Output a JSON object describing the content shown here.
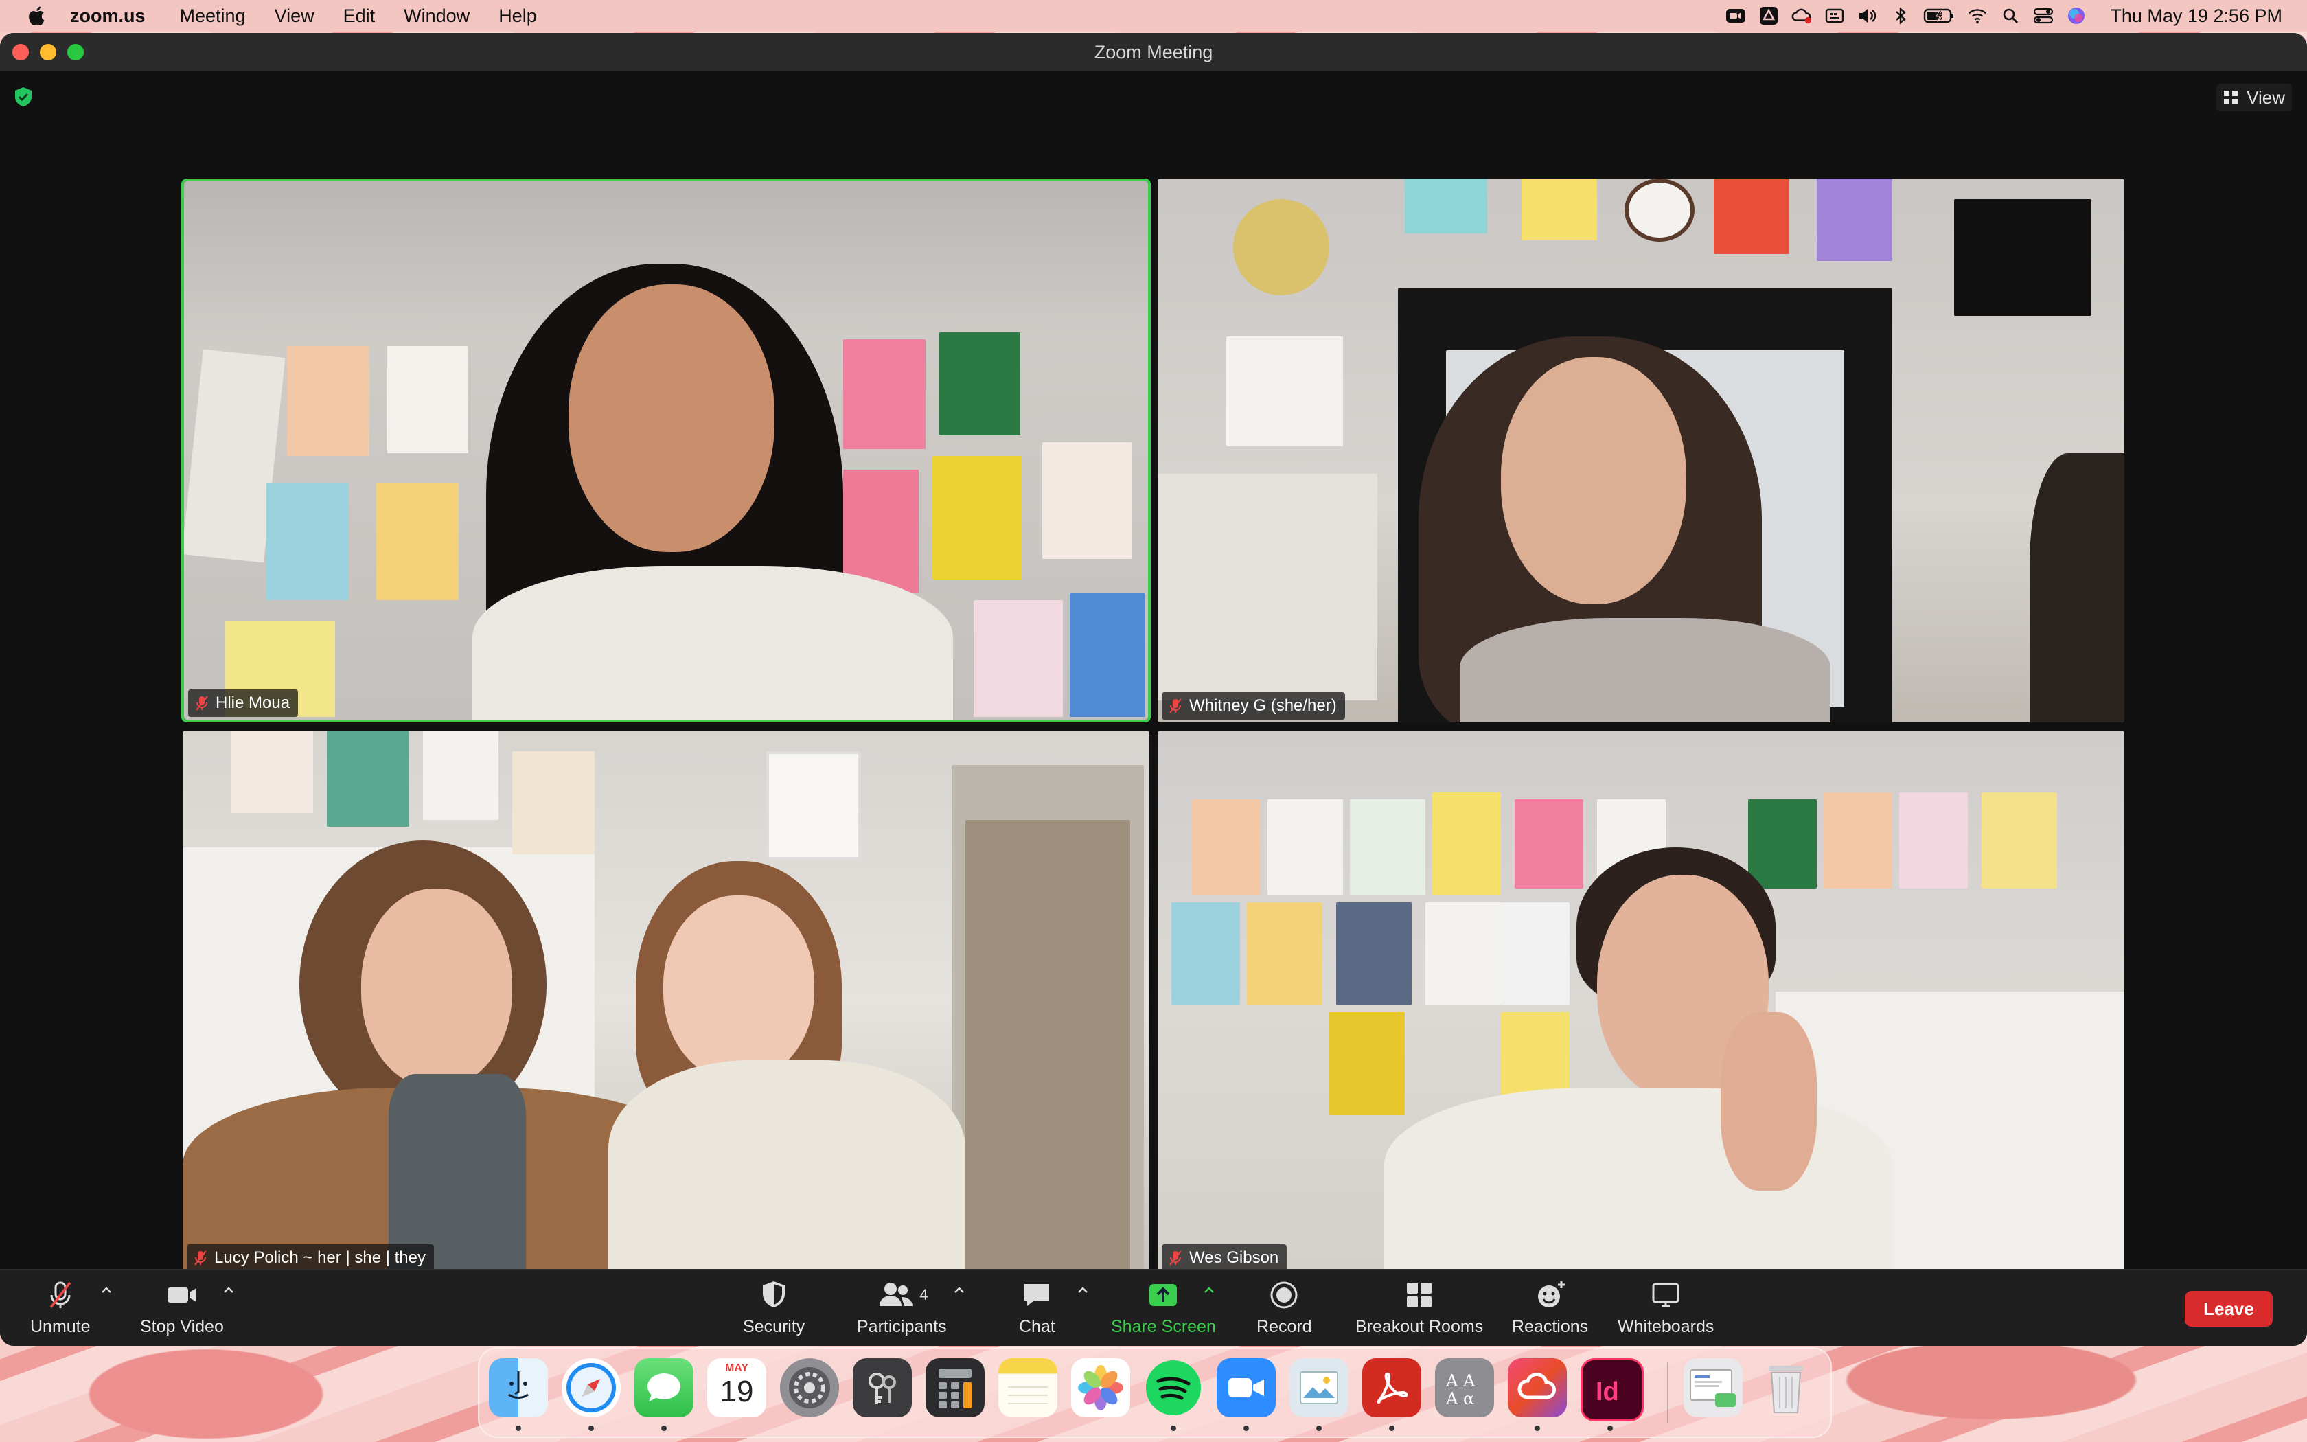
{
  "menubar": {
    "app_name": "zoom.us",
    "menus": [
      "Meeting",
      "View",
      "Edit",
      "Window",
      "Help"
    ],
    "clock": "Thu May 19  2:56 PM"
  },
  "window": {
    "title": "Zoom Meeting",
    "view_label": "View"
  },
  "participants": [
    {
      "name": "Hlie Moua",
      "muted": true,
      "active_speaker": true
    },
    {
      "name": "Whitney G (she/her)",
      "muted": true,
      "active_speaker": false
    },
    {
      "name": "Lucy Polich ~ her | she | they",
      "muted": true,
      "active_speaker": false
    },
    {
      "name": "Wes Gibson",
      "muted": true,
      "active_speaker": false
    }
  ],
  "toolbar": {
    "unmute": "Unmute",
    "stop_video": "Stop Video",
    "security": "Security",
    "participants": "Participants",
    "participant_count": "4",
    "chat": "Chat",
    "share_screen": "Share Screen",
    "record": "Record",
    "breakout_rooms": "Breakout Rooms",
    "reactions": "Reactions",
    "whiteboards": "Whiteboards",
    "leave": "Leave"
  },
  "dock": {
    "calendar_month": "MAY",
    "calendar_day": "19",
    "apps": [
      "finder-icon",
      "safari-icon",
      "messages-icon",
      "calendar-icon",
      "system-preferences-icon",
      "keychain-icon",
      "calculator-icon",
      "notes-icon",
      "photos-icon",
      "spotify-icon",
      "zoom-icon",
      "preview-icon",
      "acrobat-icon",
      "font-book-icon",
      "creative-cloud-icon",
      "indesign-icon",
      "screenshot-icon",
      "trash-icon"
    ]
  },
  "colors": {
    "accent_green": "#3ccf4e",
    "leave_red": "#d92b2b",
    "toolbar_bg": "#1f1f1f"
  }
}
